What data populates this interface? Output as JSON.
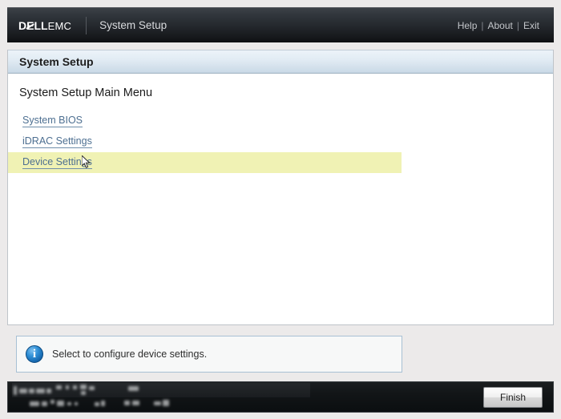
{
  "header": {
    "logo": {
      "brand_dell": "DELL",
      "brand_emc": "EMC"
    },
    "app_title": "System Setup",
    "links": [
      {
        "label": "Help"
      },
      {
        "label": "About"
      },
      {
        "label": "Exit"
      }
    ],
    "separator": "|"
  },
  "panel": {
    "title": "System Setup",
    "section_heading": "System Setup Main Menu",
    "menu_items": [
      {
        "label": "System BIOS",
        "highlighted": false
      },
      {
        "label": "iDRAC Settings",
        "highlighted": false
      },
      {
        "label": "Device Settings",
        "highlighted": true
      }
    ]
  },
  "info": {
    "icon": "info-icon",
    "message": "Select to configure device settings."
  },
  "footer": {
    "hints_obscured": true,
    "finish_label": "Finish"
  },
  "colors": {
    "header_dark": "#24282d",
    "panel_title_blue": "#e2ecf4",
    "link_blue": "#4d6f91",
    "highlight_yellow": "#f0f2b4",
    "info_border": "#a8c0d4",
    "page_background": "#eceaea"
  }
}
